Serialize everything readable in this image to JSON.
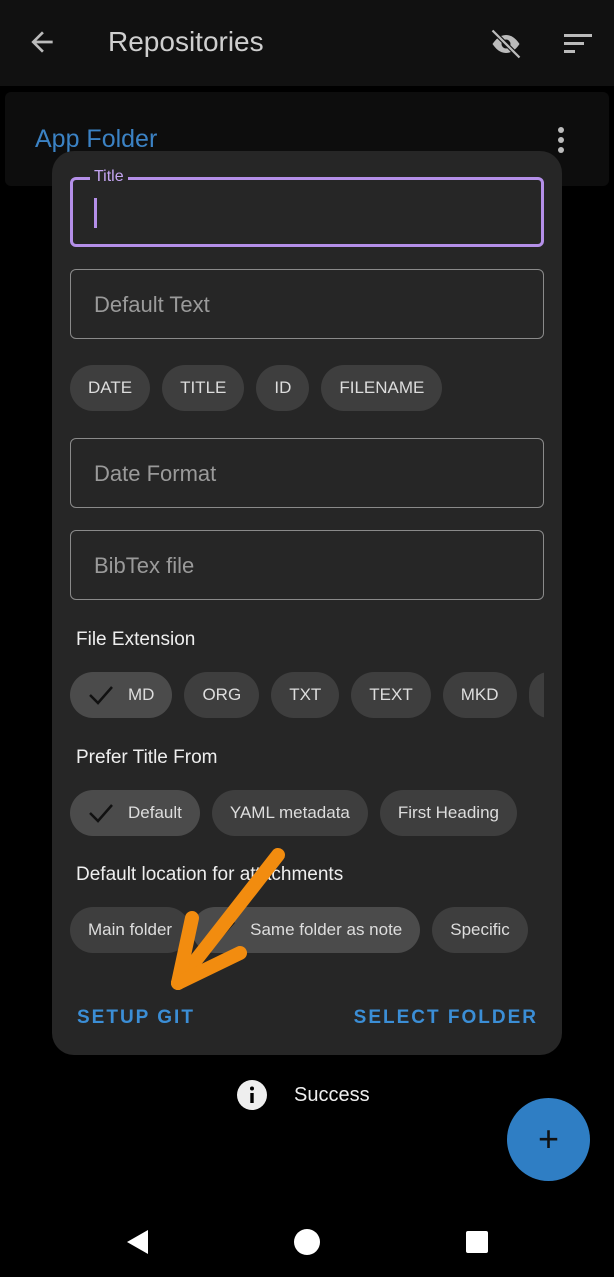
{
  "appbar": {
    "title": "Repositories",
    "back_icon": "arrow-left-icon",
    "visibility_icon": "eye-off-icon",
    "sort_icon": "sort-icon"
  },
  "repo": {
    "name": "App Folder"
  },
  "dialog": {
    "title_field": {
      "label": "Title",
      "value": ""
    },
    "default_text": {
      "placeholder": "Default Text"
    },
    "placeholders": [
      "DATE",
      "TITLE",
      "ID",
      "FILENAME"
    ],
    "date_format": {
      "placeholder": "Date Format"
    },
    "bibtex": {
      "placeholder": "BibTex file"
    },
    "file_extension": {
      "label": "File Extension",
      "options": [
        "MD",
        "ORG",
        "TXT",
        "TEXT",
        "MKD"
      ],
      "selected": "MD"
    },
    "prefer_title": {
      "label": "Prefer Title From",
      "options": [
        "Default",
        "YAML metadata",
        "First Heading"
      ],
      "selected": "Default"
    },
    "attachments": {
      "label": "Default location for attachments",
      "options": [
        "Main folder",
        "Same folder as note",
        "Specific"
      ],
      "selected": "Same folder as note"
    },
    "setup_git": "SETUP GIT",
    "select_folder": "SELECT FOLDER"
  },
  "snackbar": {
    "text": "Success",
    "icon": "info-icon"
  },
  "fab": {
    "label": "+"
  },
  "annotation": {
    "color": "#f28c0f"
  }
}
